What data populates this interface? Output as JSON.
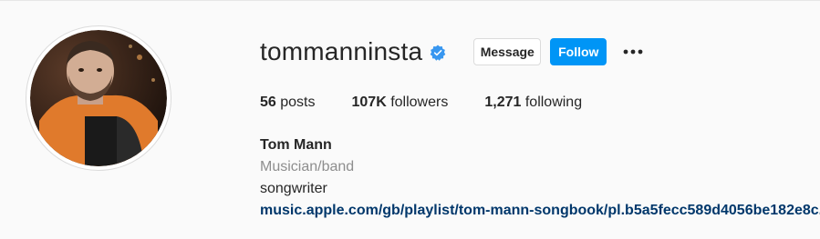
{
  "profile": {
    "username": "tommanninsta",
    "verified": true,
    "buttons": {
      "message": "Message",
      "follow": "Follow"
    },
    "stats": {
      "posts_count": "56",
      "posts_label": "posts",
      "followers_count": "107K",
      "followers_label": "followers",
      "following_count": "1,271",
      "following_label": "following"
    },
    "bio": {
      "name": "Tom Mann",
      "category": "Musician/band",
      "text": "songwriter",
      "link": "music.apple.com/gb/playlist/tom-mann-songbook/pl.b5a5fecc589d4056be182e8c..."
    }
  },
  "colors": {
    "accent": "#0095f6",
    "link": "#00376b",
    "muted": "#8e8e8e"
  },
  "icons": {
    "verified": "verified-badge-icon",
    "more": "more-options-icon"
  }
}
